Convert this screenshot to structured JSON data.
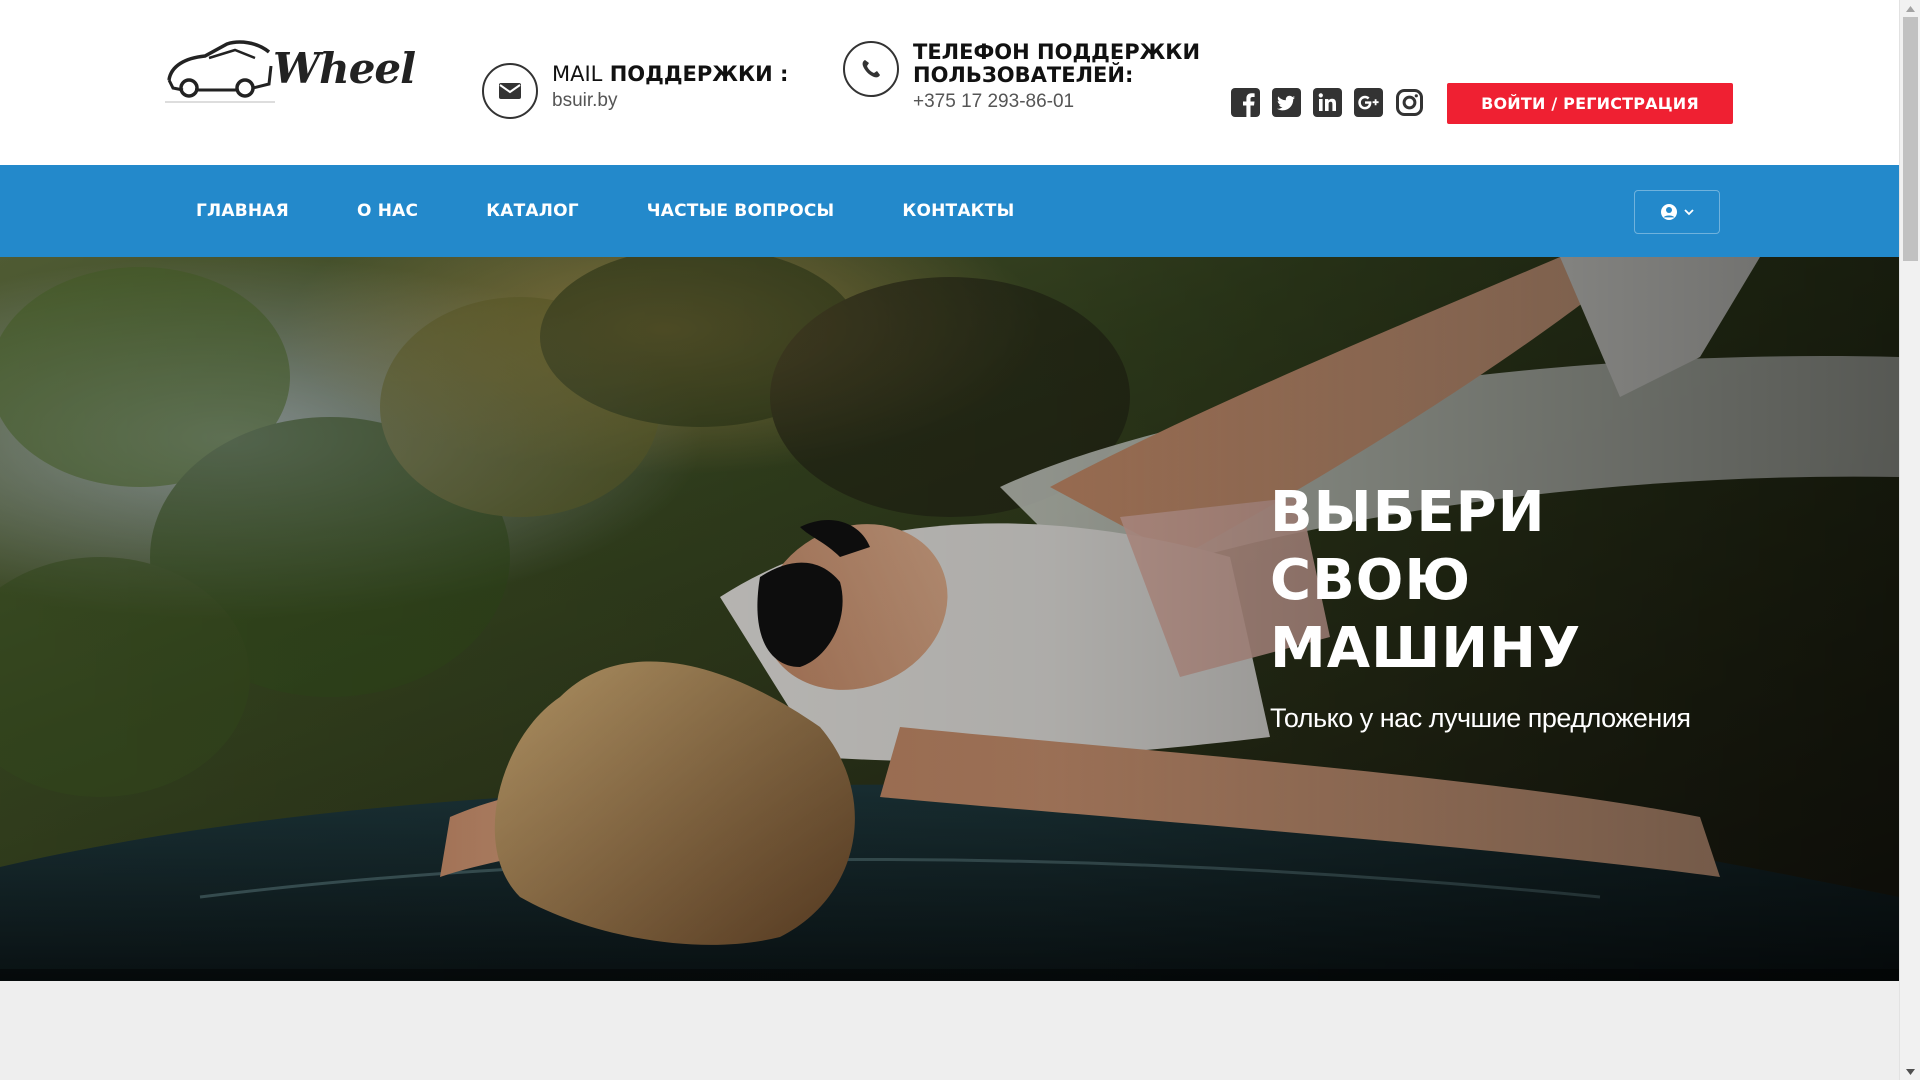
{
  "header": {
    "logo_text": "Wheel",
    "mail": {
      "title_prefix": "MAIL",
      "title_main": "ПОДДЕРЖКИ :",
      "value": "bsuir.by",
      "icon": "envelope-icon"
    },
    "phone": {
      "title_line1": "ТЕЛЕФОН ПОДДЕРЖКИ",
      "title_line2": "ПОЛЬЗОВАТЕЛЕЙ:",
      "value": "+375 17 293-86-01",
      "icon": "phone-icon"
    },
    "socials": [
      "facebook-icon",
      "twitter-icon",
      "linkedin-icon",
      "google-plus-icon",
      "instagram-icon"
    ],
    "login_label": "ВОЙТИ / РЕГИСТРАЦИЯ"
  },
  "nav": {
    "items": [
      {
        "label": "ГЛАВНАЯ"
      },
      {
        "label": "О НАС"
      },
      {
        "label": "КАТАЛОГ"
      },
      {
        "label": "ЧАСТЫЕ ВОПРОСЫ"
      },
      {
        "label": "КОНТАКТЫ"
      }
    ],
    "user_menu_icon": "user-circle-icon"
  },
  "hero": {
    "title": "ВЫБЕРИ СВОЮ МАШИНУ",
    "subtitle": "Только у нас лучшие предложения"
  },
  "colors": {
    "nav_bg": "#2389cb",
    "login_btn": "#ef2032",
    "page_bg": "#eeeeee"
  }
}
